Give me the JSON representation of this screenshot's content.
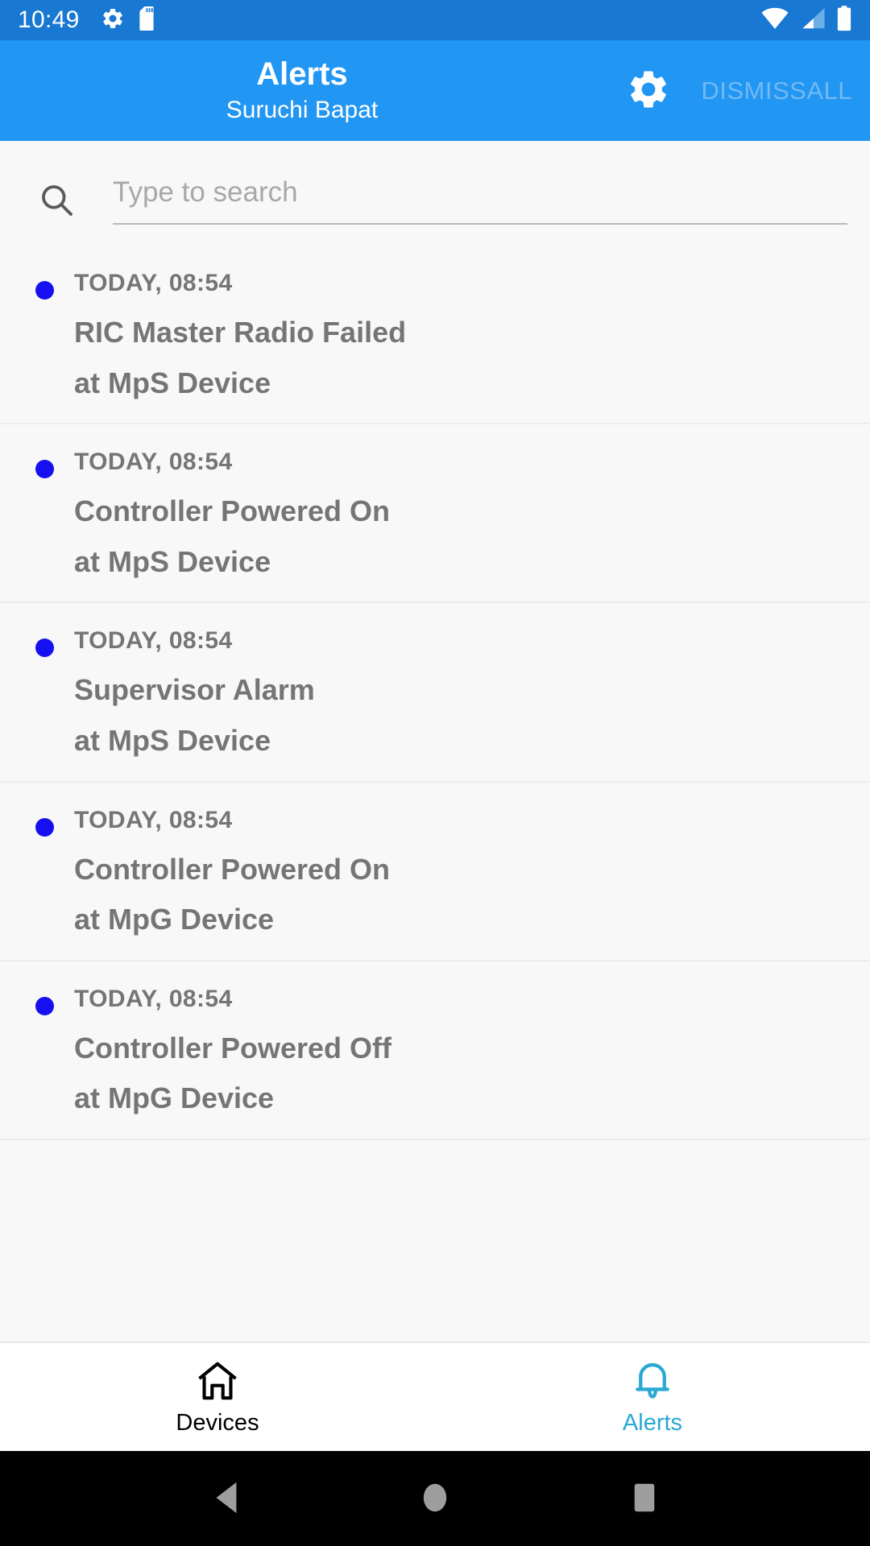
{
  "status_bar": {
    "time": "10:49",
    "icons": [
      "gear-icon",
      "sd-card-icon"
    ],
    "right_icons": [
      "wifi-icon",
      "cellular-signal-icon",
      "battery-icon"
    ],
    "background_color": "#1878D2"
  },
  "app_bar": {
    "title": "Alerts",
    "subtitle": "Suruchi Bapat",
    "settings_icon": "gear-icon",
    "dismiss_all_label": "DISMISSALL",
    "background_color": "#2196F3",
    "dismiss_color": "#73B9F3"
  },
  "search": {
    "placeholder": "Type to search",
    "value": "",
    "icon": "search-icon"
  },
  "alerts": {
    "unread_dot_color": "#1610F0",
    "items": [
      {
        "time": "TODAY, 08:54",
        "title": "RIC Master Radio Failed",
        "device": "at MpS Device"
      },
      {
        "time": "TODAY, 08:54",
        "title": "Controller Powered On",
        "device": "at MpS Device"
      },
      {
        "time": "TODAY, 08:54",
        "title": "Supervisor Alarm",
        "device": "at MpS Device"
      },
      {
        "time": "TODAY, 08:54",
        "title": "Controller Powered On",
        "device": "at MpG Device"
      },
      {
        "time": "TODAY, 08:54",
        "title": "Controller Powered Off",
        "device": "at MpG Device"
      }
    ]
  },
  "bottom_nav": {
    "active_color": "#29A8D4",
    "inactive_color": "#000000",
    "tabs": [
      {
        "label": "Devices",
        "icon": "home-icon",
        "active": false
      },
      {
        "label": "Alerts",
        "icon": "bell-icon",
        "active": true
      }
    ]
  },
  "android_nav": {
    "buttons": [
      "back-icon",
      "home-icon",
      "recents-icon"
    ],
    "color": "#9E9E9E",
    "background_color": "#000000"
  }
}
